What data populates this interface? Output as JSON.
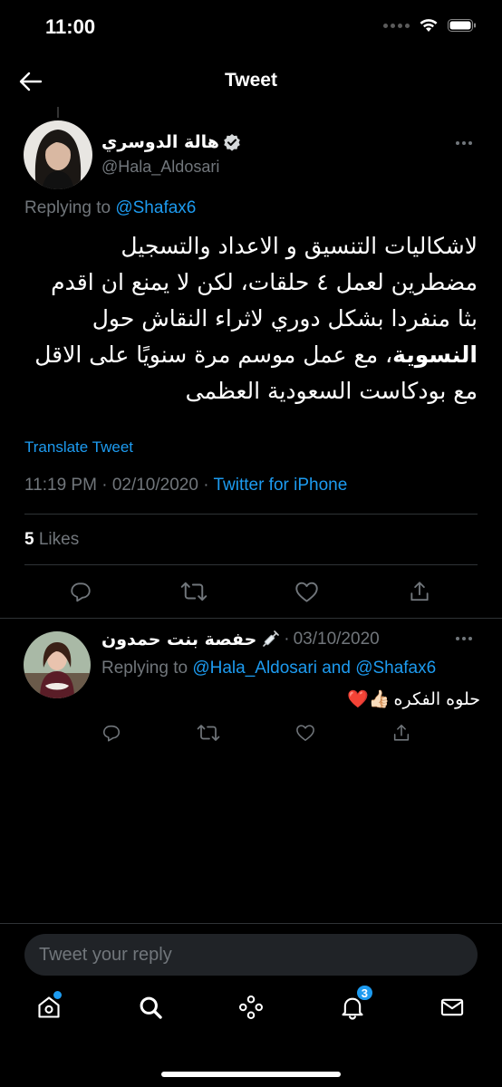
{
  "status_bar": {
    "time": "11:00"
  },
  "nav": {
    "title": "Tweet"
  },
  "tweet": {
    "author_name": "هالة الدوسري",
    "author_handle": "@Hala_Aldosari",
    "replying_prefix": "Replying to",
    "replying_to": "@Shafax6",
    "text_lines": [
      "لاشكاليات التنسيق و الاعداد والتسجيل",
      "مضطرين لعمل ٤ حلقات، لكن لا يمنع ان اقدم",
      "بثا منفردا بشكل دوري لاثراء النقاش حول",
      "، مع عمل موسم مرة سنويًا على الاقل",
      "مع بودكاست السعودية العظمى"
    ],
    "text_bold_word": "النسوية",
    "translate_label": "Translate Tweet",
    "time": "11:19 PM",
    "date": "02/10/2020",
    "meta_separator": "·",
    "source": "Twitter for iPhone",
    "likes_count": "5",
    "likes_label": "Likes"
  },
  "reply": {
    "author_name": "حفصة بنت حمدون",
    "date": "03/10/2020",
    "date_separator": "·",
    "replying_prefix": "Replying to",
    "replying_to_1": "@Hala_Aldosari",
    "replying_and": "and",
    "replying_to_2": "@Shafax6",
    "text": "حلوه الفكره",
    "emoji": "👍🏻❤️"
  },
  "compose": {
    "placeholder": "Tweet your reply"
  },
  "tabbar": {
    "notifications_badge": "3"
  },
  "colors": {
    "accent": "#1d9bf0",
    "background": "#000000",
    "secondary_text": "#71767b",
    "divider": "#2f3336"
  }
}
